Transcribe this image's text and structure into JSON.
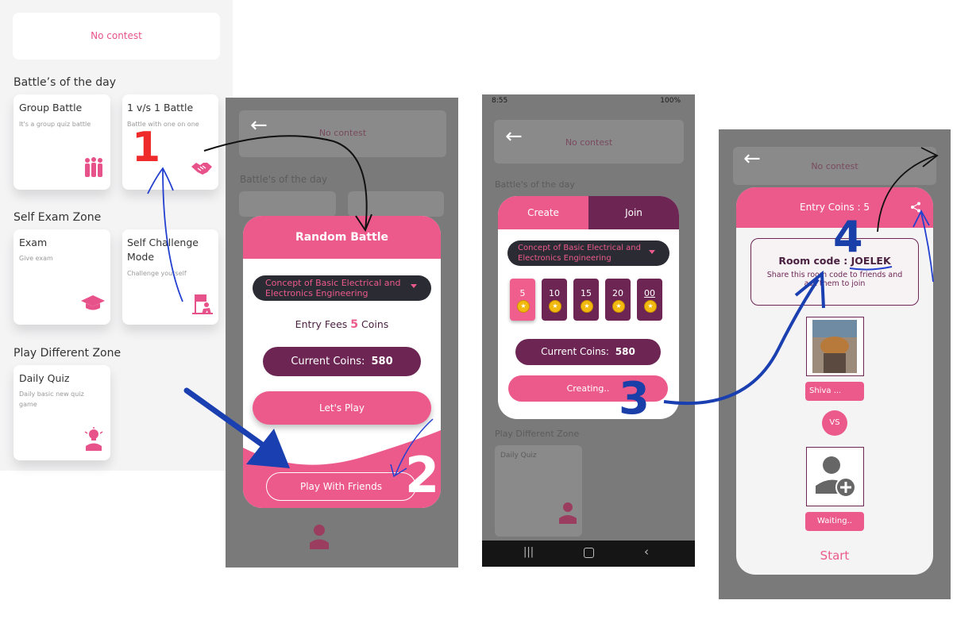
{
  "panel1": {
    "no_contest": "No contest",
    "battles_heading": "Battle’s of the day",
    "group_battle": {
      "title": "Group Battle",
      "sub": "It's a group quiz battle"
    },
    "one_v_one": {
      "title": "1 v/s 1 Battle",
      "sub": "Battle with one on one"
    },
    "self_exam_heading": "Self Exam Zone",
    "exam": {
      "title": "Exam",
      "sub": "Give exam"
    },
    "self_challenge": {
      "title": "Self Challenge Mode",
      "sub": "Challenge yourself"
    },
    "play_zone_heading": "Play Different Zone",
    "daily_quiz": {
      "title": "Daily Quiz",
      "sub": "Daily basic new quiz game"
    }
  },
  "panel2": {
    "ghost_no_contest": "No contest",
    "ghost_battles": "Battle's of the day",
    "title": "Random Battle",
    "dropdown": "Concept of Basic Electrical and Electronics Engineering",
    "entry_prefix": "Entry Fees",
    "entry_value": "5",
    "entry_suffix": "Coins",
    "coins_label": "Current Coins:",
    "coins_value": "580",
    "lets_play": "Let's Play",
    "play_friends": "Play With Friends"
  },
  "panel3": {
    "status_time": "8:55",
    "status_right": "100%",
    "ghost_no_contest": "No contest",
    "ghost_battles": "Battle's of the day",
    "ghost_play_zone": "Play Different Zone",
    "ghost_daily": "Daily Quiz",
    "tab_create": "Create",
    "tab_join": "Join",
    "dropdown": "Concept of Basic Electrical and Electronics Engineering",
    "entries": [
      "5",
      "10",
      "15",
      "20",
      "00"
    ],
    "coins_label": "Current Coins:",
    "coins_value": "580",
    "creating": "Creating.."
  },
  "panel4": {
    "ghost_no_contest": "No contest",
    "entry_coins": "Entry Coins : 5",
    "room_code_label": "Room code :",
    "room_code_value": "JOELEK",
    "share_text": "Share this room code to friends and ask them to join",
    "player_name": "Shiva ...",
    "vs": "VS",
    "waiting": "Waiting..",
    "start": "Start"
  },
  "annotations": {
    "step1": "1",
    "step2": "2",
    "step3": "3",
    "step4": "4"
  },
  "colors": {
    "pink": "#ec5a8c",
    "plum": "#6d2654",
    "dark": "#2b2b33",
    "red_step": "#ee2a2a",
    "blue_step": "#1b3fa8"
  }
}
